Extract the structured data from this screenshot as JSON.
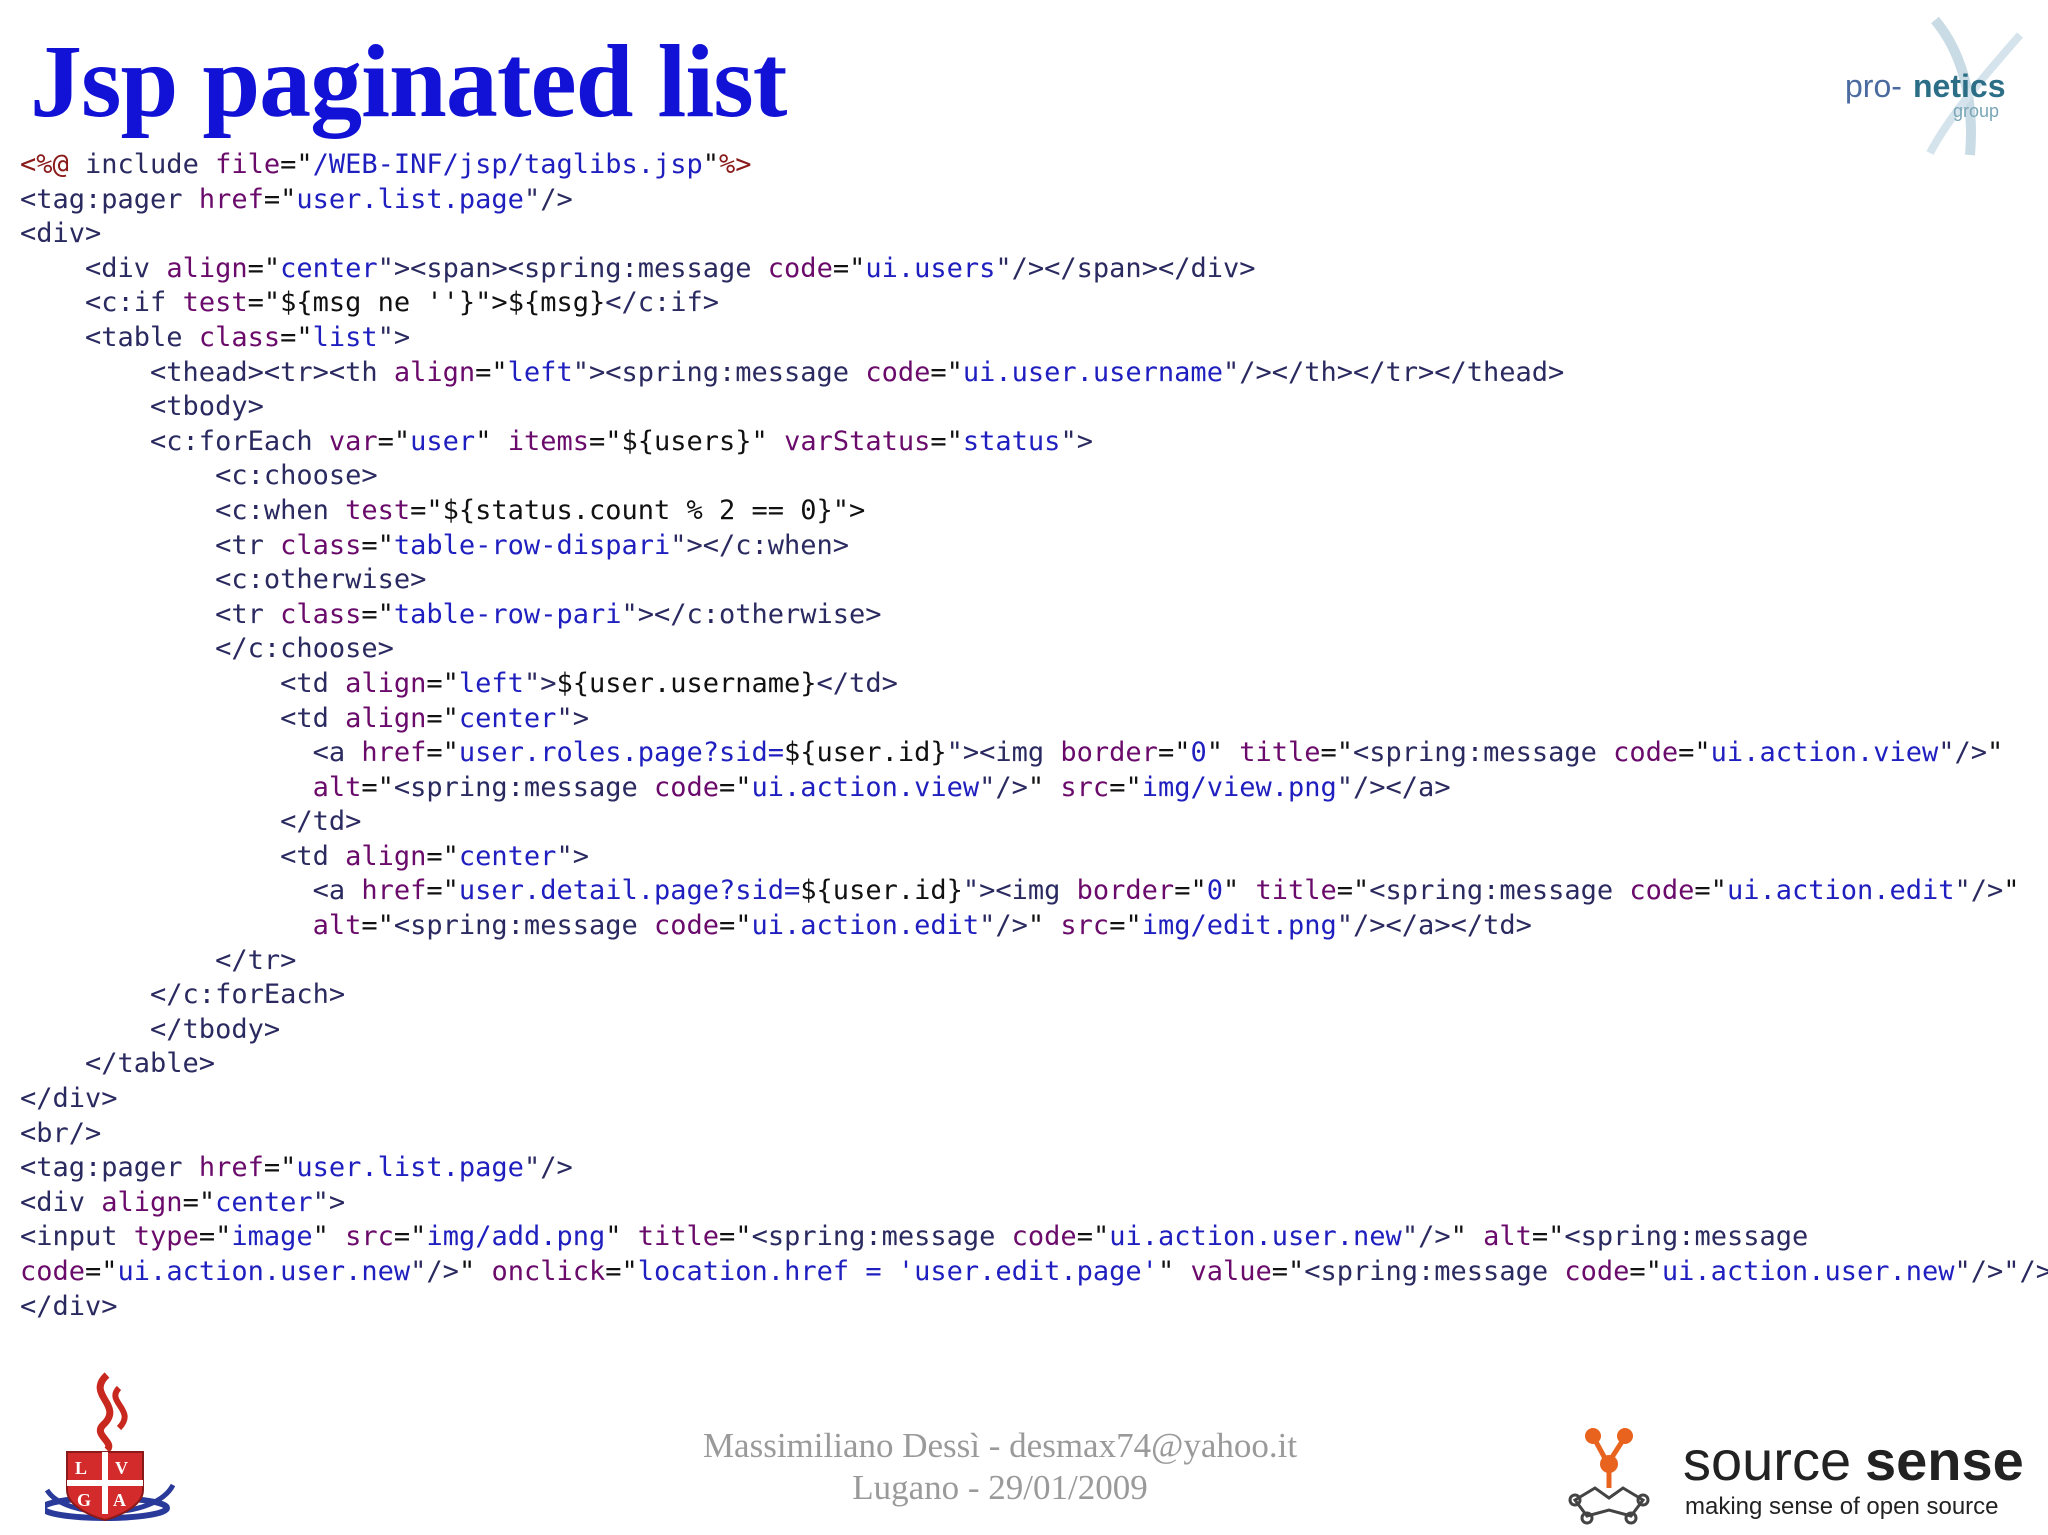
{
  "slide": {
    "title": "Jsp paginated list"
  },
  "code_lines": [
    [
      {
        "t": "<%@ ",
        "c": "dir"
      },
      {
        "t": "include ",
        "c": "tag"
      },
      {
        "t": "file",
        "c": "attr"
      },
      {
        "t": "=\"",
        "c": "txt"
      },
      {
        "t": "/WEB-INF/jsp/taglibs.jsp",
        "c": "val"
      },
      {
        "t": "\"",
        "c": "txt"
      },
      {
        "t": "%>",
        "c": "dir"
      }
    ],
    [
      {
        "t": "<tag:pager ",
        "c": "tag"
      },
      {
        "t": "href",
        "c": "attr"
      },
      {
        "t": "=\"",
        "c": "txt"
      },
      {
        "t": "user.list.page",
        "c": "val"
      },
      {
        "t": "\"/>",
        "c": "tag"
      }
    ],
    [
      {
        "t": "<div>",
        "c": "tag"
      }
    ],
    [
      {
        "t": "    <div ",
        "c": "tag"
      },
      {
        "t": "align",
        "c": "attr"
      },
      {
        "t": "=\"",
        "c": "txt"
      },
      {
        "t": "center",
        "c": "val"
      },
      {
        "t": "\"><span><spring:message ",
        "c": "tag"
      },
      {
        "t": "code",
        "c": "attr"
      },
      {
        "t": "=\"",
        "c": "txt"
      },
      {
        "t": "ui.users",
        "c": "val"
      },
      {
        "t": "\"/></span></div>",
        "c": "tag"
      }
    ],
    [
      {
        "t": "    <c:if ",
        "c": "tag"
      },
      {
        "t": "test",
        "c": "attr"
      },
      {
        "t": "=\"${msg ne ''}\">",
        "c": "txt"
      },
      {
        "t": "${msg}",
        "c": "txt"
      },
      {
        "t": "</c:if>",
        "c": "tag"
      }
    ],
    [
      {
        "t": "    <table ",
        "c": "tag"
      },
      {
        "t": "class",
        "c": "attr"
      },
      {
        "t": "=\"",
        "c": "txt"
      },
      {
        "t": "list",
        "c": "val"
      },
      {
        "t": "\">",
        "c": "tag"
      }
    ],
    [
      {
        "t": "        <thead><tr><th ",
        "c": "tag"
      },
      {
        "t": "align",
        "c": "attr"
      },
      {
        "t": "=\"",
        "c": "txt"
      },
      {
        "t": "left",
        "c": "val"
      },
      {
        "t": "\"><spring:message ",
        "c": "tag"
      },
      {
        "t": "code",
        "c": "attr"
      },
      {
        "t": "=\"",
        "c": "txt"
      },
      {
        "t": "ui.user.username",
        "c": "val"
      },
      {
        "t": "\"/></th></tr></thead>",
        "c": "tag"
      }
    ],
    [
      {
        "t": "        <tbody>",
        "c": "tag"
      }
    ],
    [
      {
        "t": "        <c:forEach ",
        "c": "tag"
      },
      {
        "t": "var",
        "c": "attr"
      },
      {
        "t": "=\"",
        "c": "txt"
      },
      {
        "t": "user",
        "c": "val"
      },
      {
        "t": "\" ",
        "c": "txt"
      },
      {
        "t": "items",
        "c": "attr"
      },
      {
        "t": "=\"${users}\" ",
        "c": "txt"
      },
      {
        "t": "varStatus",
        "c": "attr"
      },
      {
        "t": "=\"",
        "c": "txt"
      },
      {
        "t": "status",
        "c": "val"
      },
      {
        "t": "\">",
        "c": "tag"
      }
    ],
    [
      {
        "t": "            <c:choose>",
        "c": "tag"
      }
    ],
    [
      {
        "t": "            <c:when ",
        "c": "tag"
      },
      {
        "t": "test",
        "c": "attr"
      },
      {
        "t": "=\"${status.count % 2 == 0}\">",
        "c": "txt"
      }
    ],
    [
      {
        "t": "            <tr ",
        "c": "tag"
      },
      {
        "t": "class",
        "c": "attr"
      },
      {
        "t": "=\"",
        "c": "txt"
      },
      {
        "t": "table-row-dispari",
        "c": "val"
      },
      {
        "t": "\"></c:when>",
        "c": "tag"
      }
    ],
    [
      {
        "t": "            <c:otherwise>",
        "c": "tag"
      }
    ],
    [
      {
        "t": "            <tr ",
        "c": "tag"
      },
      {
        "t": "class",
        "c": "attr"
      },
      {
        "t": "=\"",
        "c": "txt"
      },
      {
        "t": "table-row-pari",
        "c": "val"
      },
      {
        "t": "\"></c:otherwise>",
        "c": "tag"
      }
    ],
    [
      {
        "t": "            </c:choose>",
        "c": "tag"
      }
    ],
    [
      {
        "t": "                <td ",
        "c": "tag"
      },
      {
        "t": "align",
        "c": "attr"
      },
      {
        "t": "=\"",
        "c": "txt"
      },
      {
        "t": "left",
        "c": "val"
      },
      {
        "t": "\">",
        "c": "tag"
      },
      {
        "t": "${user.username}",
        "c": "txt"
      },
      {
        "t": "</td>",
        "c": "tag"
      }
    ],
    [
      {
        "t": "                <td ",
        "c": "tag"
      },
      {
        "t": "align",
        "c": "attr"
      },
      {
        "t": "=\"",
        "c": "txt"
      },
      {
        "t": "center",
        "c": "val"
      },
      {
        "t": "\">",
        "c": "tag"
      }
    ],
    [
      {
        "t": "                  <a ",
        "c": "tag"
      },
      {
        "t": "href",
        "c": "attr"
      },
      {
        "t": "=\"",
        "c": "txt"
      },
      {
        "t": "user.roles.page?sid=",
        "c": "val"
      },
      {
        "t": "${user.id}",
        "c": "txt"
      },
      {
        "t": "\"><img ",
        "c": "tag"
      },
      {
        "t": "border",
        "c": "attr"
      },
      {
        "t": "=\"",
        "c": "txt"
      },
      {
        "t": "0",
        "c": "val"
      },
      {
        "t": "\" ",
        "c": "txt"
      },
      {
        "t": "title",
        "c": "attr"
      },
      {
        "t": "=\"",
        "c": "txt"
      },
      {
        "t": "<spring:message ",
        "c": "tag"
      },
      {
        "t": "code",
        "c": "attr"
      },
      {
        "t": "=\"",
        "c": "txt"
      },
      {
        "t": "ui.action.view",
        "c": "val"
      },
      {
        "t": "\"/>",
        "c": "tag"
      },
      {
        "t": "\"",
        "c": "txt"
      }
    ],
    [
      {
        "t": "                  alt",
        "c": "attr"
      },
      {
        "t": "=\"",
        "c": "txt"
      },
      {
        "t": "<spring:message ",
        "c": "tag"
      },
      {
        "t": "code",
        "c": "attr"
      },
      {
        "t": "=\"",
        "c": "txt"
      },
      {
        "t": "ui.action.view",
        "c": "val"
      },
      {
        "t": "\"/>",
        "c": "tag"
      },
      {
        "t": "\" ",
        "c": "txt"
      },
      {
        "t": "src",
        "c": "attr"
      },
      {
        "t": "=\"",
        "c": "txt"
      },
      {
        "t": "img/view.png",
        "c": "val"
      },
      {
        "t": "\"/></a>",
        "c": "tag"
      }
    ],
    [
      {
        "t": "                </td>",
        "c": "tag"
      }
    ],
    [
      {
        "t": "                <td ",
        "c": "tag"
      },
      {
        "t": "align",
        "c": "attr"
      },
      {
        "t": "=\"",
        "c": "txt"
      },
      {
        "t": "center",
        "c": "val"
      },
      {
        "t": "\">",
        "c": "tag"
      }
    ],
    [
      {
        "t": "                  <a ",
        "c": "tag"
      },
      {
        "t": "href",
        "c": "attr"
      },
      {
        "t": "=\"",
        "c": "txt"
      },
      {
        "t": "user.detail.page?sid=",
        "c": "val"
      },
      {
        "t": "${user.id}",
        "c": "txt"
      },
      {
        "t": "\"><img ",
        "c": "tag"
      },
      {
        "t": "border",
        "c": "attr"
      },
      {
        "t": "=\"",
        "c": "txt"
      },
      {
        "t": "0",
        "c": "val"
      },
      {
        "t": "\" ",
        "c": "txt"
      },
      {
        "t": "title",
        "c": "attr"
      },
      {
        "t": "=\"",
        "c": "txt"
      },
      {
        "t": "<spring:message ",
        "c": "tag"
      },
      {
        "t": "code",
        "c": "attr"
      },
      {
        "t": "=\"",
        "c": "txt"
      },
      {
        "t": "ui.action.edit",
        "c": "val"
      },
      {
        "t": "\"/>",
        "c": "tag"
      },
      {
        "t": "\"",
        "c": "txt"
      }
    ],
    [
      {
        "t": "                  alt",
        "c": "attr"
      },
      {
        "t": "=\"",
        "c": "txt"
      },
      {
        "t": "<spring:message ",
        "c": "tag"
      },
      {
        "t": "code",
        "c": "attr"
      },
      {
        "t": "=\"",
        "c": "txt"
      },
      {
        "t": "ui.action.edit",
        "c": "val"
      },
      {
        "t": "\"/>",
        "c": "tag"
      },
      {
        "t": "\" ",
        "c": "txt"
      },
      {
        "t": "src",
        "c": "attr"
      },
      {
        "t": "=\"",
        "c": "txt"
      },
      {
        "t": "img/edit.png",
        "c": "val"
      },
      {
        "t": "\"/></a></td>",
        "c": "tag"
      }
    ],
    [
      {
        "t": "            </tr>",
        "c": "tag"
      }
    ],
    [
      {
        "t": "        </c:forEach>",
        "c": "tag"
      }
    ],
    [
      {
        "t": "        </tbody>",
        "c": "tag"
      }
    ],
    [
      {
        "t": "    </table>",
        "c": "tag"
      }
    ],
    [
      {
        "t": "</div>",
        "c": "tag"
      }
    ],
    [
      {
        "t": "<br/>",
        "c": "tag"
      }
    ],
    [
      {
        "t": "<tag:pager ",
        "c": "tag"
      },
      {
        "t": "href",
        "c": "attr"
      },
      {
        "t": "=\"",
        "c": "txt"
      },
      {
        "t": "user.list.page",
        "c": "val"
      },
      {
        "t": "\"/>",
        "c": "tag"
      }
    ],
    [
      {
        "t": "<div ",
        "c": "tag"
      },
      {
        "t": "align",
        "c": "attr"
      },
      {
        "t": "=\"",
        "c": "txt"
      },
      {
        "t": "center",
        "c": "val"
      },
      {
        "t": "\">",
        "c": "tag"
      }
    ],
    [
      {
        "t": "<input ",
        "c": "tag"
      },
      {
        "t": "type",
        "c": "attr"
      },
      {
        "t": "=\"",
        "c": "txt"
      },
      {
        "t": "image",
        "c": "val"
      },
      {
        "t": "\" ",
        "c": "txt"
      },
      {
        "t": "src",
        "c": "attr"
      },
      {
        "t": "=\"",
        "c": "txt"
      },
      {
        "t": "img/add.png",
        "c": "val"
      },
      {
        "t": "\" ",
        "c": "txt"
      },
      {
        "t": "title",
        "c": "attr"
      },
      {
        "t": "=\"",
        "c": "txt"
      },
      {
        "t": "<spring:message ",
        "c": "tag"
      },
      {
        "t": "code",
        "c": "attr"
      },
      {
        "t": "=\"",
        "c": "txt"
      },
      {
        "t": "ui.action.user.new",
        "c": "val"
      },
      {
        "t": "\"/>",
        "c": "tag"
      },
      {
        "t": "\" ",
        "c": "txt"
      },
      {
        "t": "alt",
        "c": "attr"
      },
      {
        "t": "=\"",
        "c": "txt"
      },
      {
        "t": "<spring:message",
        "c": "tag"
      }
    ],
    [
      {
        "t": "code",
        "c": "attr"
      },
      {
        "t": "=\"",
        "c": "txt"
      },
      {
        "t": "ui.action.user.new",
        "c": "val"
      },
      {
        "t": "\"/>",
        "c": "tag"
      },
      {
        "t": "\" ",
        "c": "txt"
      },
      {
        "t": "onclick",
        "c": "attr"
      },
      {
        "t": "=\"",
        "c": "txt"
      },
      {
        "t": "location.href = 'user.edit.page'",
        "c": "val"
      },
      {
        "t": "\" ",
        "c": "txt"
      },
      {
        "t": "value",
        "c": "attr"
      },
      {
        "t": "=\"",
        "c": "txt"
      },
      {
        "t": "<spring:message ",
        "c": "tag"
      },
      {
        "t": "code",
        "c": "attr"
      },
      {
        "t": "=\"",
        "c": "txt"
      },
      {
        "t": "ui.action.user.new",
        "c": "val"
      },
      {
        "t": "\"/>",
        "c": "tag"
      },
      {
        "t": "\"/>",
        "c": "tag"
      }
    ],
    [
      {
        "t": "</div>",
        "c": "tag"
      }
    ]
  ],
  "logos": {
    "top_right": {
      "text_pro": "pro-",
      "text_netics": "netics",
      "text_group": "group"
    },
    "bottom_left": {
      "letters": [
        "L",
        "V",
        "G",
        "A"
      ]
    },
    "bottom_right": {
      "brand_light": "source",
      "brand_bold": "sense",
      "tagline": "making sense of open source"
    }
  },
  "footer": {
    "line1": "Massimiliano Dessì - desmax74@yahoo.it",
    "line2": "Lugano - 29/01/2009"
  },
  "colors": {
    "title": "#1212d6",
    "code_tag": "#2a2a60",
    "code_attr": "#6a0a6a",
    "code_value": "#1f1fc0",
    "footer": "#9a9a9a",
    "sourcesense_orange": "#e8641e",
    "pronetics_teal": "#2b8a9a"
  }
}
